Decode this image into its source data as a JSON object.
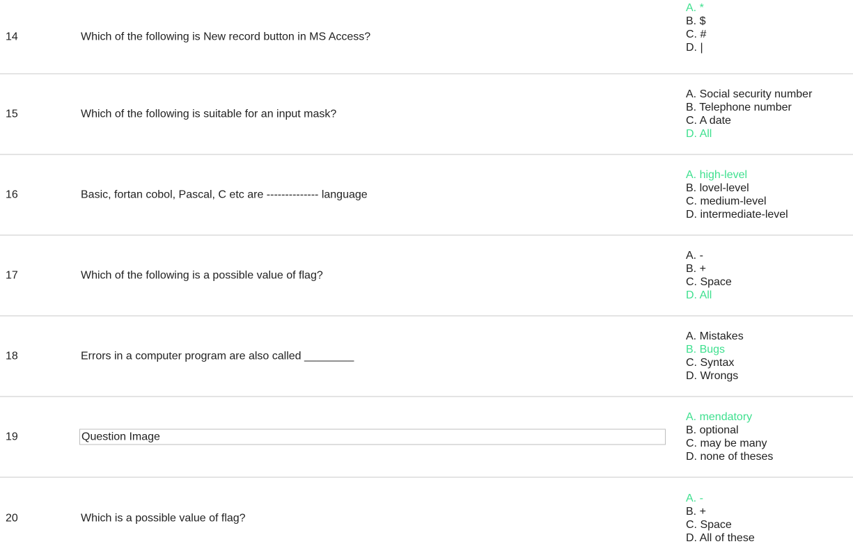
{
  "colors": {
    "correct": "#3fe08f",
    "text": "#222222",
    "divider": "#e4e4e4"
  },
  "questions": [
    {
      "number": "14",
      "text": "Which of the following is New record button in MS Access?",
      "is_image": false,
      "options": [
        {
          "label": "A. *",
          "correct": true
        },
        {
          "label": "B. $",
          "correct": false
        },
        {
          "label": "C. #",
          "correct": false
        },
        {
          "label": "D. |",
          "correct": false
        }
      ]
    },
    {
      "number": "15",
      "text": "Which of the following is suitable for an input mask?",
      "is_image": false,
      "options": [
        {
          "label": "A. Social security number",
          "correct": false
        },
        {
          "label": "B. Telephone number",
          "correct": false
        },
        {
          "label": "C. A date",
          "correct": false
        },
        {
          "label": "D. All",
          "correct": true
        }
      ]
    },
    {
      "number": "16",
      "text": "Basic, fortan cobol, Pascal, C etc are -------------- language",
      "is_image": false,
      "options": [
        {
          "label": "A. high-level",
          "correct": true
        },
        {
          "label": "B. lovel-level",
          "correct": false
        },
        {
          "label": "C. medium-level",
          "correct": false
        },
        {
          "label": "D. intermediate-level",
          "correct": false
        }
      ]
    },
    {
      "number": "17",
      "text": "Which of the following is a possible value of flag?",
      "is_image": false,
      "options": [
        {
          "label": "A. -",
          "correct": false
        },
        {
          "label": "B. +",
          "correct": false
        },
        {
          "label": "C. Space",
          "correct": false
        },
        {
          "label": "D. All",
          "correct": true
        }
      ]
    },
    {
      "number": "18",
      "text": "Errors in a computer program are also called ________",
      "is_image": false,
      "options": [
        {
          "label": "A. Mistakes",
          "correct": false
        },
        {
          "label": "B. Bugs",
          "correct": true
        },
        {
          "label": "C. Syntax",
          "correct": false
        },
        {
          "label": "D. Wrongs",
          "correct": false
        }
      ]
    },
    {
      "number": "19",
      "text": "Question Image",
      "is_image": true,
      "options": [
        {
          "label": "A. mendatory",
          "correct": true
        },
        {
          "label": "B. optional",
          "correct": false
        },
        {
          "label": "C. may be many",
          "correct": false
        },
        {
          "label": "D. none of theses",
          "correct": false
        }
      ]
    },
    {
      "number": "20",
      "text": "Which is a possible value of flag?",
      "is_image": false,
      "options": [
        {
          "label": "A. -",
          "correct": true
        },
        {
          "label": "B. +",
          "correct": false
        },
        {
          "label": "C. Space",
          "correct": false
        },
        {
          "label": "D. All of these",
          "correct": false
        }
      ]
    }
  ]
}
